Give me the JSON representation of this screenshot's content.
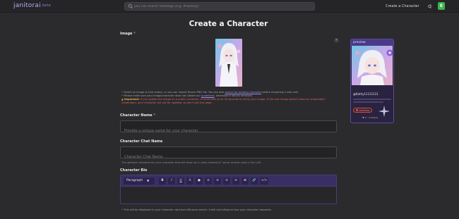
{
  "header": {
    "logo": "janitorai",
    "logo_badge": "beta",
    "search_placeholder": "you can search hashtags (e.g. #fantasy)",
    "create_link": "Create a Character",
    "avatar_letter": "E"
  },
  "page": {
    "title": "Create a Character"
  },
  "image_section": {
    "label": "Image",
    "required_mark": "*",
    "close_symbol": "×",
    "note_1_pre": "Select an image or text avatar, or you can import Tavern PNG file. You can also",
    "note_1_link": "search for existing character",
    "note_1_post": "before importing a new one!",
    "note_2_pre": "Please make sure your image/character does not violate our",
    "note_2_link": "guidelines",
    "note_2_post": ", otherwise it will be removed.",
    "note_3_label": "Important:",
    "note_3_text": "If you update the image on a public character, it could take up to 30 seconds to verify your image. If the new image doesn't pass our automated moderation, your character will not be updated, so don't exit this page."
  },
  "name_section": {
    "label": "Character Name",
    "required_mark": "*",
    "placeholder": "Provide a unique name for your character"
  },
  "chat_name_section": {
    "label": "Character Chat Name",
    "placeholder": "Character Chat Name",
    "help": "The optional nickname for your character that will show up in chats instead of 'name' and be used in the LLM."
  },
  "bio_section": {
    "label": "Character Bio",
    "paragraph_select": "Paragraph",
    "toolbar": [
      "B",
      "I",
      "U",
      "A",
      "●",
      "≡",
      "≡",
      "≡",
      "≡",
      "⊞",
      "🔗",
      "</>"
    ],
    "bottom_note": "This will be displayed in your character card and influence search, it will not influence how your character responds."
  },
  "preview": {
    "header": "preview",
    "creator": "@Kathy11111111",
    "badge": "Limitless",
    "stats": "♥ 0  ◦ 0 tokens"
  },
  "colors": {
    "accent": "#7b68ee",
    "background": "#2b2b2e",
    "limitless": "#d24c4c"
  }
}
